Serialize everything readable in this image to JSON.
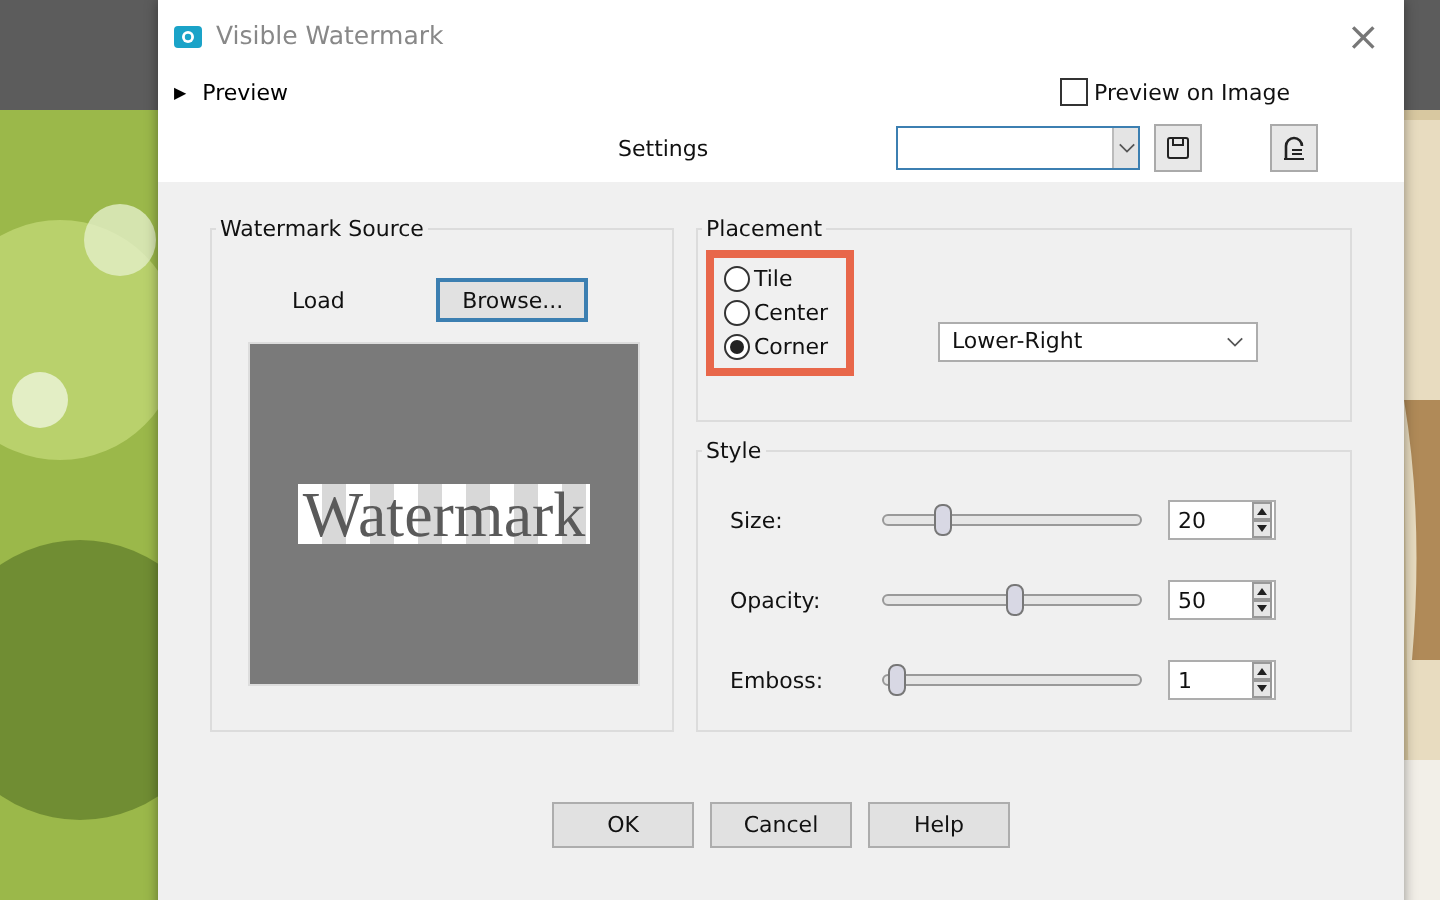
{
  "window": {
    "title": "Visible Watermark",
    "close": "×"
  },
  "preview": {
    "label": "Preview",
    "expander": "▶",
    "expanded": false
  },
  "preview_on_image": {
    "label": "Preview on Image",
    "checked": false
  },
  "settings": {
    "label": "Settings"
  },
  "watermark_source": {
    "title": "Watermark Source",
    "load_label": "Load",
    "browse": "Browse...",
    "sample_text": "Watermark"
  },
  "placement": {
    "title": "Placement",
    "options": [
      {
        "label": "Tile",
        "selected": false
      },
      {
        "label": "Center",
        "selected": false
      },
      {
        "label": "Corner",
        "selected": true
      }
    ],
    "corner": "Lower-Right"
  },
  "style": {
    "title": "Style",
    "sliders": [
      {
        "label": "Size:",
        "level": 0.22,
        "value": "20"
      },
      {
        "label": "Opacity:",
        "level": 0.5,
        "value": "50"
      },
      {
        "label": "Emboss:",
        "level": 0.04,
        "value": "1"
      }
    ]
  },
  "buttons": [
    "OK",
    "Cancel",
    "Help"
  ]
}
